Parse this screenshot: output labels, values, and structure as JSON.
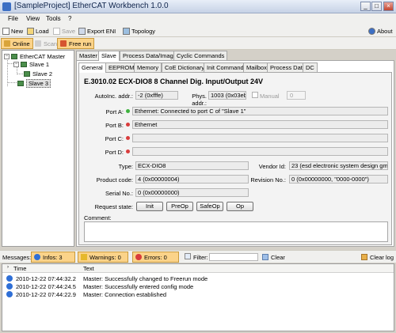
{
  "window": {
    "title": "[SampleProject] EtherCAT Workbench 1.0.0"
  },
  "menu": {
    "items": [
      "File",
      "View",
      "Tools",
      "?"
    ]
  },
  "toolbar": {
    "new": "New",
    "load": "Load",
    "save": "Save",
    "export": "Export ENI",
    "topology": "Topology",
    "about": "About"
  },
  "toolbar2": {
    "online": "Online",
    "scan": "Scan",
    "free_run": "Free run"
  },
  "tree": {
    "master": "EtherCAT Master",
    "slave1": "Slave 1",
    "slave2": "Slave 2",
    "slave3": "Slave 3"
  },
  "outer_tabs": [
    "Master",
    "Slave",
    "Process Data/Image",
    "Cyclic Commands"
  ],
  "inner_tabs": [
    "General",
    "EEPROM",
    "Memory",
    "CoE Dictionary",
    "Init Commands",
    "Mailbox",
    "Process Data",
    "DC"
  ],
  "general": {
    "heading": "E.3010.02 ECX-DIO8 8 Channel Dig. Input/Output 24V",
    "autoinc_label": "AutoInc. addr.:",
    "autoinc_value": "-2 (0xfffe)",
    "phys_label": "Phys. addr.:",
    "phys_value": "1003 (0x03eb)",
    "manual_label": "Manual",
    "manual_value": "0",
    "port_a_label": "Port A:",
    "port_a_value": "Ethernet: Connected to port C of \"Slave 1\"",
    "port_b_label": "Port B:",
    "port_b_value": "Ethernet",
    "port_c_label": "Port C:",
    "port_c_value": "",
    "port_d_label": "Port D:",
    "port_d_value": "",
    "type_label": "Type:",
    "type_value": "ECX-DIO8",
    "vendor_label": "Vendor Id:",
    "vendor_value": "23 (esd electronic system design gmbh)",
    "product_label": "Product code:",
    "product_value": "4 (0x00000004)",
    "revision_label": "Revision No.:",
    "revision_value": "0 (0x00000000, \"0000-0000\")",
    "serial_label": "Serial No.:",
    "serial_value": "0 (0x00000000)",
    "request_label": "Request state:",
    "btn_init": "Init",
    "btn_preop": "PreOp",
    "btn_safeop": "SafeOp",
    "btn_op": "Op",
    "comment_label": "Comment:",
    "comment_value": ""
  },
  "messages_bar": {
    "label": "Messages:",
    "infos": "Infos: 3",
    "warnings": "Warnings: 0",
    "errors": "Errors: 0",
    "filter_label": "Filter:",
    "filter_value": "",
    "clear": "Clear",
    "clear_log": "Clear log"
  },
  "messages": {
    "col_time": "Time",
    "col_text": "Text",
    "rows": [
      {
        "time": "2010-12-22 07:44:32.2",
        "text": "Master: Successfully changed to Freerun mode"
      },
      {
        "time": "2010-12-22 07:44:24.5",
        "text": "Master: Successfully entered config mode"
      },
      {
        "time": "2010-12-22 07:44:22.9",
        "text": "Master: Connection established"
      }
    ]
  },
  "colors": {
    "port_green": "#3fb23f",
    "port_red": "#d93c3c",
    "highlight": "#fbd389",
    "info_blue": "#2f6fd6"
  }
}
